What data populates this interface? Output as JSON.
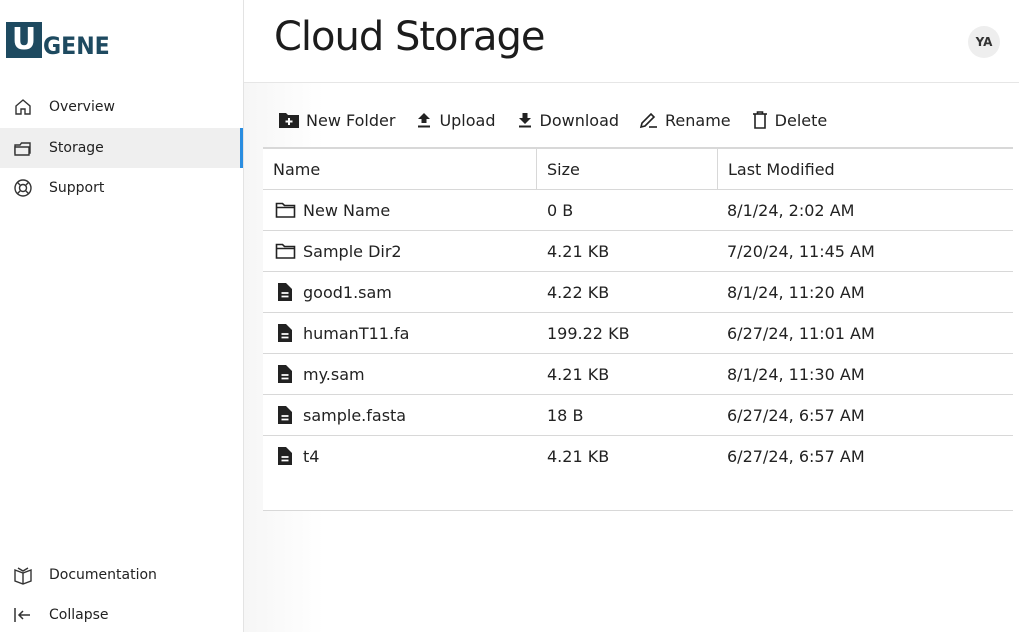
{
  "brand": {
    "logo_letter": "U",
    "logo_rest": "GENE",
    "accent": "#2a8de0",
    "logo_color": "#1e4a60"
  },
  "sidebar": {
    "items": [
      {
        "label": "Overview",
        "icon": "home-icon",
        "active": false
      },
      {
        "label": "Storage",
        "icon": "folders-icon",
        "active": true
      },
      {
        "label": "Support",
        "icon": "lifebuoy-icon",
        "active": false
      }
    ],
    "bottom": [
      {
        "label": "Documentation",
        "icon": "book-icon"
      },
      {
        "label": "Collapse",
        "icon": "collapse-left-icon"
      }
    ]
  },
  "header": {
    "title": "Cloud Storage",
    "avatar_initials": "YA"
  },
  "toolbar": {
    "new_folder": "New Folder",
    "upload": "Upload",
    "download": "Download",
    "rename": "Rename",
    "delete": "Delete"
  },
  "table": {
    "columns": [
      "Name",
      "Size",
      "Last Modified"
    ],
    "rows": [
      {
        "type": "folder",
        "name": "New Name",
        "size": "0 B",
        "modified": "8/1/24, 2:02 AM"
      },
      {
        "type": "folder",
        "name": "Sample Dir2",
        "size": "4.21 KB",
        "modified": "7/20/24, 11:45 AM"
      },
      {
        "type": "file",
        "name": "good1.sam",
        "size": "4.22 KB",
        "modified": "8/1/24, 11:20 AM"
      },
      {
        "type": "file",
        "name": "humanT11.fa",
        "size": "199.22 KB",
        "modified": "6/27/24, 11:01 AM"
      },
      {
        "type": "file",
        "name": "my.sam",
        "size": "4.21 KB",
        "modified": "8/1/24, 11:30 AM"
      },
      {
        "type": "file",
        "name": "sample.fasta",
        "size": "18 B",
        "modified": "6/27/24, 6:57 AM"
      },
      {
        "type": "file",
        "name": "t4",
        "size": "4.21 KB",
        "modified": "6/27/24, 6:57 AM"
      }
    ]
  }
}
